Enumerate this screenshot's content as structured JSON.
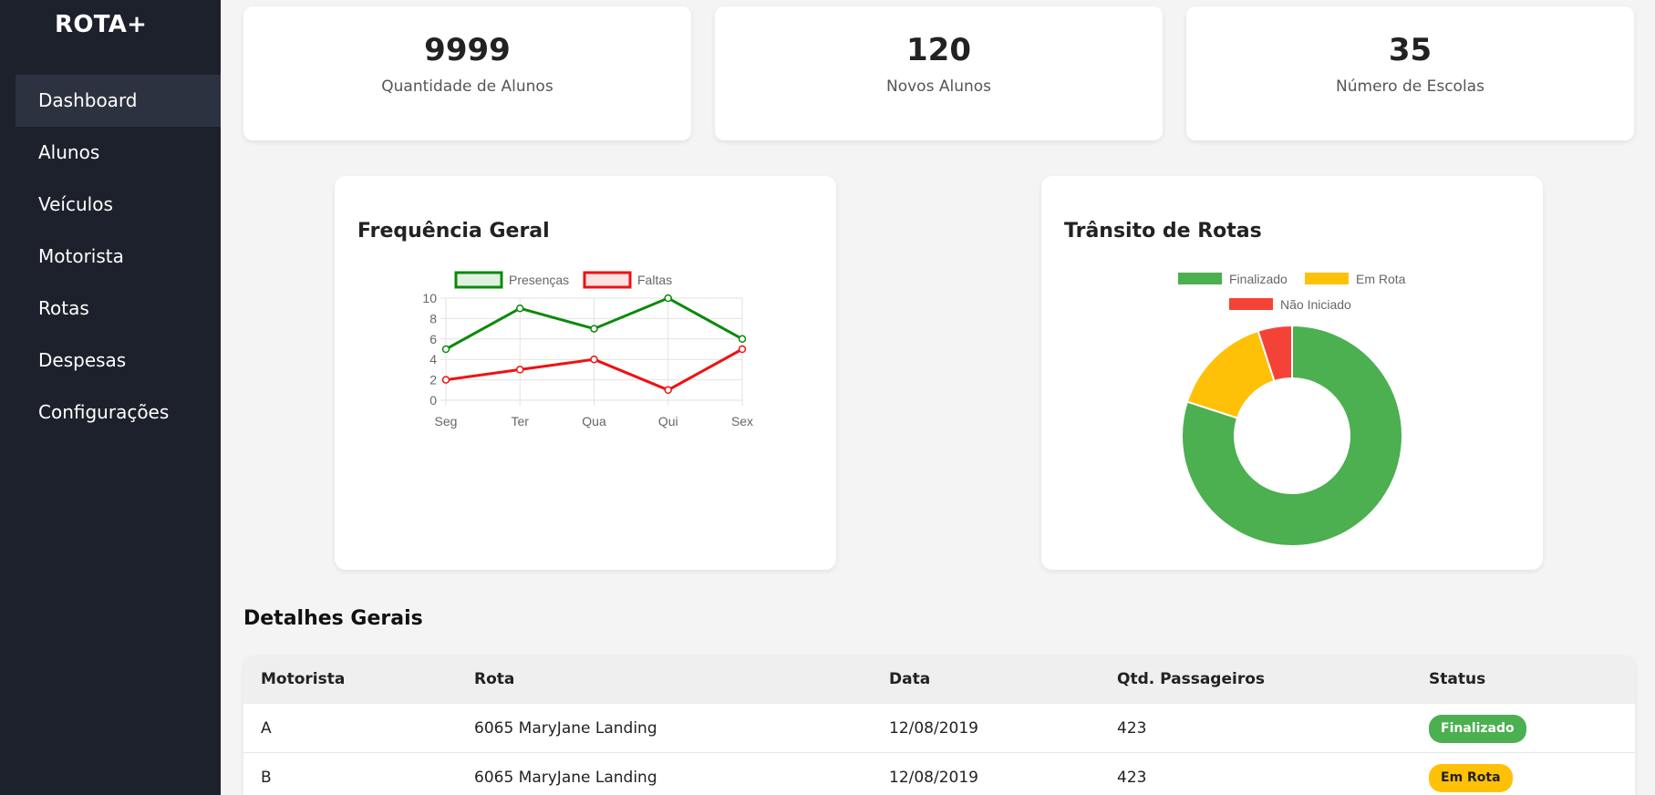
{
  "app": {
    "brand": "ROTA+"
  },
  "sidebar": {
    "items": [
      {
        "label": "Dashboard",
        "active": true
      },
      {
        "label": "Alunos"
      },
      {
        "label": "Veículos"
      },
      {
        "label": "Motorista"
      },
      {
        "label": "Rotas"
      },
      {
        "label": "Despesas"
      },
      {
        "label": "Configurações"
      }
    ]
  },
  "stats": [
    {
      "value": "9999",
      "label": "Quantidade de Alunos"
    },
    {
      "value": "120",
      "label": "Novos Alunos"
    },
    {
      "value": "35",
      "label": "Número de Escolas"
    }
  ],
  "charts": {
    "frequencia": {
      "title": "Frequência Geral"
    },
    "transito": {
      "title": "Trânsito de Rotas"
    }
  },
  "chart_data": [
    {
      "type": "line",
      "title": "Frequência Geral",
      "categories": [
        "Seg",
        "Ter",
        "Qua",
        "Qui",
        "Sex"
      ],
      "series": [
        {
          "name": "Presenças",
          "values": [
            5,
            9,
            7,
            10,
            6
          ],
          "color": "#0a8a0a"
        },
        {
          "name": "Faltas",
          "values": [
            2,
            3,
            4,
            1,
            5
          ],
          "color": "#ee1111"
        }
      ],
      "ylim": [
        0,
        10
      ],
      "yticks": [
        0,
        2,
        4,
        6,
        8,
        10
      ],
      "grid": true,
      "legend": "top"
    },
    {
      "type": "pie",
      "title": "Trânsito de Rotas",
      "donut": true,
      "labels": [
        "Finalizado",
        "Em Rota",
        "Não Iniciado"
      ],
      "values": [
        80,
        15,
        5
      ],
      "colors": [
        "#4caf50",
        "#ffc107",
        "#f44336"
      ],
      "legend": "top"
    }
  ],
  "details": {
    "title": "Detalhes Gerais",
    "columns": [
      "Motorista",
      "Rota",
      "Data",
      "Qtd. Passageiros",
      "Status"
    ],
    "rows": [
      {
        "motorista": "A",
        "rota": "6065 MaryJane Landing",
        "data": "12/08/2019",
        "qtd": "423",
        "status": "Finalizado",
        "status_color": "#4caf50",
        "status_text_color": "#ffffff"
      },
      {
        "motorista": "B",
        "rota": "6065 MaryJane Landing",
        "data": "12/08/2019",
        "qtd": "423",
        "status": "Em Rota",
        "status_color": "#ffc107",
        "status_text_color": "#222222"
      }
    ]
  }
}
